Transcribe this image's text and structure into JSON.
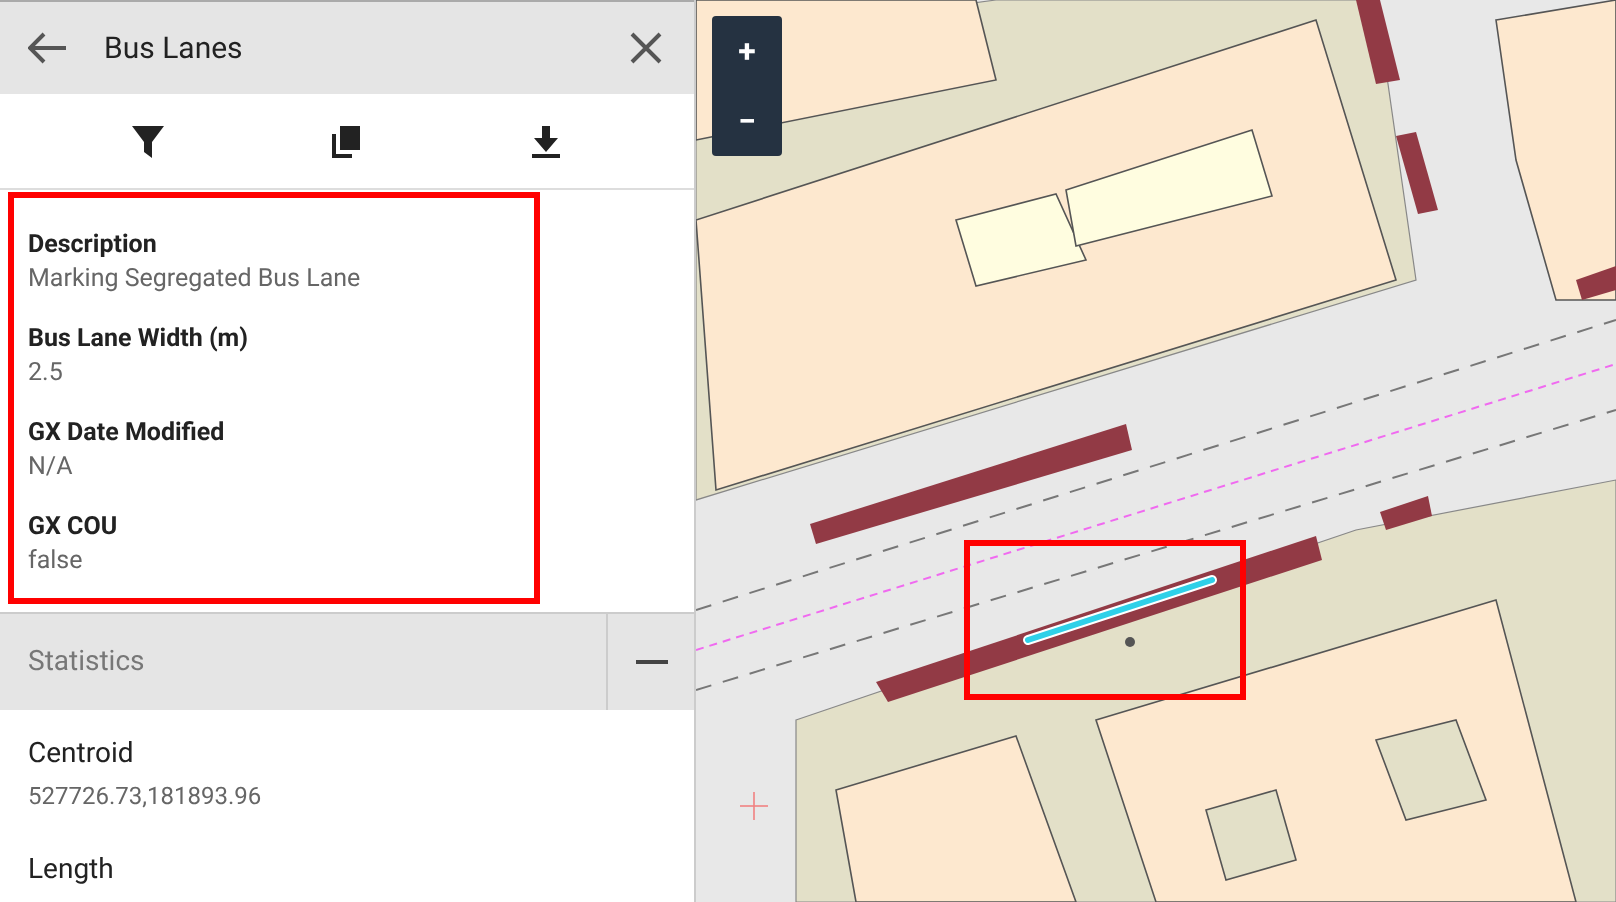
{
  "panel": {
    "title": "Bus Lanes"
  },
  "attributes": [
    {
      "label": "Description",
      "value": "Marking Segregated Bus Lane"
    },
    {
      "label": "Bus Lane Width (m)",
      "value": "2.5"
    },
    {
      "label": "GX Date Modified",
      "value": "N/A"
    },
    {
      "label": "GX COU",
      "value": "false"
    }
  ],
  "statistics": {
    "title": "Statistics",
    "expanded": true,
    "items": [
      {
        "label": "Centroid",
        "value": "527726.73,181893.96"
      },
      {
        "label": "Length"
      }
    ]
  },
  "map": {
    "zoom_in": "+",
    "zoom_out": "−"
  }
}
